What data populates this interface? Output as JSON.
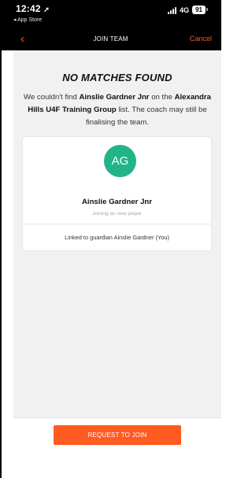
{
  "status_bar": {
    "time": "12:42",
    "back_app": "◂ App Store",
    "network": "4G",
    "battery": "91"
  },
  "nav": {
    "title": "JOIN TEAM",
    "cancel": "Cancel"
  },
  "content": {
    "heading": "NO MATCHES FOUND",
    "message_part1": "We couldn't find ",
    "message_player": "Ainslie Gardner Jnr",
    "message_part2": " on the ",
    "message_team": "Alexandra Hills U4F Training Group",
    "message_part3": " list. The coach may still be finalising the team."
  },
  "player_card": {
    "avatar_initials": "AG",
    "avatar_color": "#22b489",
    "name": "Ainslie Gardner Jnr",
    "subtitle": "Joining as new player",
    "guardian_text": "Linked to guardian Ainslie Gardner (You)"
  },
  "footer": {
    "request_button": "REQUEST TO JOIN"
  },
  "colors": {
    "accent": "#ff5a1f"
  }
}
